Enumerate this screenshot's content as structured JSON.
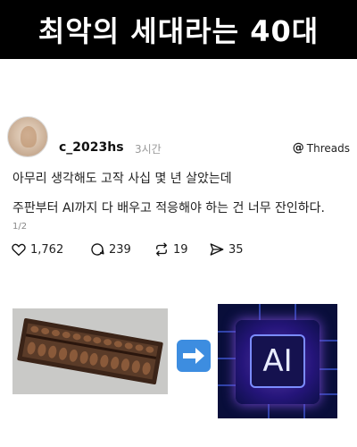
{
  "banner": {
    "title": "최악의 세대라는 40대"
  },
  "post": {
    "username": "c_2023hs",
    "timestamp": "3시간",
    "platform_label": "Threads",
    "body_lines": [
      "아무리 생각해도 고작 사십 몇 년 살았는데",
      "주판부터 AI까지 다 배우고 적응해야 하는 건 너무 잔인하다."
    ],
    "page_indicator": "1/2",
    "stats": {
      "likes": "1,762",
      "comments": "239",
      "reposts": "19",
      "shares": "35"
    }
  },
  "images": {
    "right_chip_text": "AI"
  },
  "colors": {
    "banner_bg": "#000000",
    "arrow_box": "#3d8de0",
    "chip_bg": "#090e3a"
  },
  "icons": [
    "heart-icon",
    "comment-icon",
    "repost-icon",
    "share-icon",
    "threads-logo-icon",
    "right-arrow-icon"
  ]
}
